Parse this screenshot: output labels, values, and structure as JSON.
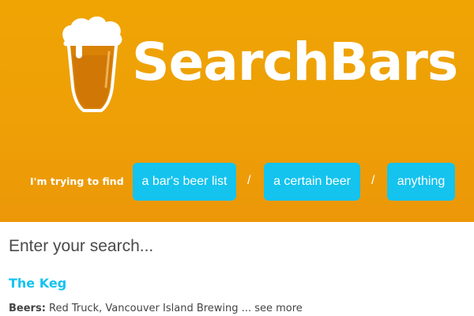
{
  "brand": {
    "name": "SearchBars",
    "logo_icon": "beer-glass-icon",
    "colors": {
      "header_bg": "#ee9f06",
      "accent": "#14c3ee",
      "beer": "#d98205",
      "foam": "#ffffff"
    }
  },
  "finder": {
    "prompt": "I'm trying to find",
    "separator": "/",
    "options": [
      {
        "label": "a bar's beer list"
      },
      {
        "label": "a certain beer"
      },
      {
        "label": "anything"
      }
    ]
  },
  "search": {
    "placeholder": "Enter your search...",
    "value": ""
  },
  "results": [
    {
      "title": "The Keg",
      "beers_label": "Beers:",
      "beers": "Red Truck, Vancouver Island Brewing",
      "more_label": "... see more"
    }
  ]
}
